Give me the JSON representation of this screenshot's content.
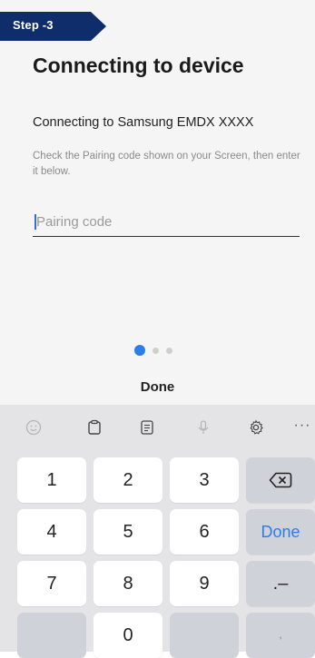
{
  "step": {
    "label": "Step -3",
    "color": "#0f2c6b"
  },
  "page": {
    "title": "Connecting to device",
    "subtitle": "Connecting to Samsung EMDX XXXX",
    "help_text": "Check the Pairing code shown on your Screen, then enter it below."
  },
  "pairing_input": {
    "value": "",
    "placeholder": "Pairing code"
  },
  "pager": {
    "count": 3,
    "active_index": 0
  },
  "done_action": "Done",
  "keyboard": {
    "toolbar": [
      "emoji-icon",
      "clipboard-icon",
      "text-editor-icon",
      "microphone-icon",
      "settings-icon",
      "more-icon"
    ],
    "more_label": "···",
    "keys": {
      "k1": "1",
      "k2": "2",
      "k3": "3",
      "k4": "4",
      "k5": "5",
      "k6": "6",
      "k7": "7",
      "k8": "8",
      "k9": "9",
      "k0": "0",
      "done": "Done",
      "dot_dash": ".–",
      "comma": ","
    },
    "accent_color": "#2b7de9"
  }
}
